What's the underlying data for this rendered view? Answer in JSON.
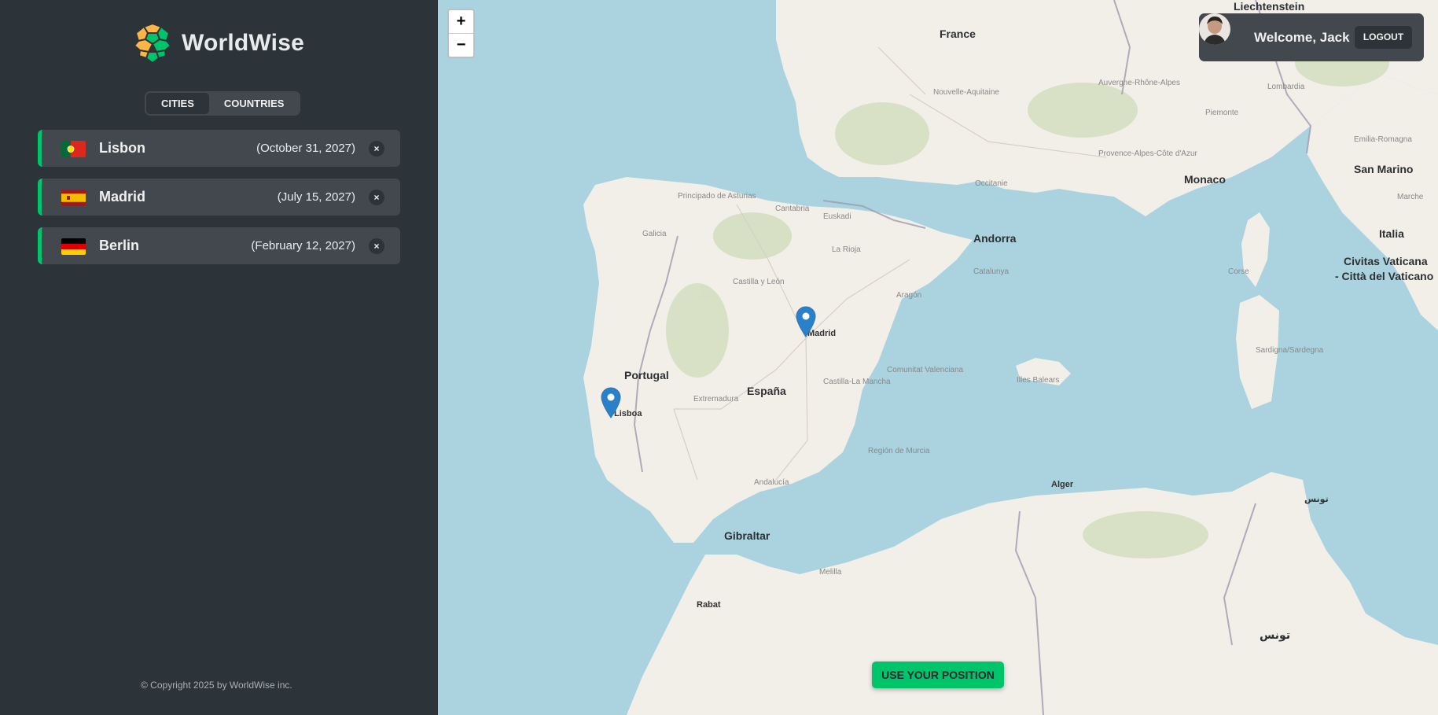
{
  "app": {
    "name": "WorldWise"
  },
  "tabs": [
    {
      "label": "CITIES",
      "active": true
    },
    {
      "label": "COUNTRIES",
      "active": false
    }
  ],
  "cities": [
    {
      "name": "Lisbon",
      "date": "(October 31, 2027)",
      "flag": "flag-portugal"
    },
    {
      "name": "Madrid",
      "date": "(July 15, 2027)",
      "flag": "flag-spain"
    },
    {
      "name": "Berlin",
      "date": "(February 12, 2027)",
      "flag": "flag-germany"
    }
  ],
  "delete_symbol": "×",
  "copyright": "© Copyright 2025 by WorldWise inc.",
  "map": {
    "zoom_in": "+",
    "zoom_out": "−",
    "use_position": "USE YOUR POSITION",
    "labels": {
      "france": "France",
      "liechtenstein": "Liechtenstein",
      "monaco": "Monaco",
      "san_marino": "San Marino",
      "andorra": "Andorra",
      "italia": "Italia",
      "vaticano1": "Civitas Vaticana",
      "vaticano2": "- Città del Vaticano",
      "portugal": "Portugal",
      "espana": "España",
      "madrid": "Madrid",
      "lisboa": "Lisboa",
      "gibraltar": "Gibraltar",
      "alger": "Alger",
      "rabat": "Rabat",
      "tunis_ar": "تونس",
      "tunisia_ar": "تونس",
      "galicia": "Galicia",
      "extremadura": "Extremadura",
      "andalucia": "Andalucía",
      "aragon": "Aragón",
      "catalunya": "Catalunya",
      "castilla_mancha": "Castilla-La Mancha",
      "illes_balears": "Illes Balears",
      "sardegna": "Sardigna/Sardegna",
      "occitanie": "Occitanie",
      "nouvelle_aquitaine": "Nouvelle-Aquitaine",
      "piemonte": "Piemonte",
      "lombardia": "Lombardia",
      "emilia": "Emilia-Romagna",
      "comunitat": "Comunitat Valenciana",
      "murcia": "Región de Murcia",
      "castilla_leon": "Castilla y León",
      "principado": "Principado de Asturias",
      "cantabria": "Cantabria",
      "la_rioja": "La Rioja",
      "euskadi": "Euskadi",
      "melilla": "Melilla",
      "provence": "Provence-Alpes-Côte d'Azur",
      "auvergne": "Auvergne-Rhône-Alpes",
      "corse": "Corse",
      "marche": "Marche"
    }
  },
  "user": {
    "welcome": "Welcome, Jack",
    "logout": "LOGOUT"
  },
  "colors": {
    "accent": "#00c46a",
    "sidebar": "#2d3439",
    "panel": "#42484d",
    "water": "#aad3df",
    "land": "#f2efe9"
  }
}
